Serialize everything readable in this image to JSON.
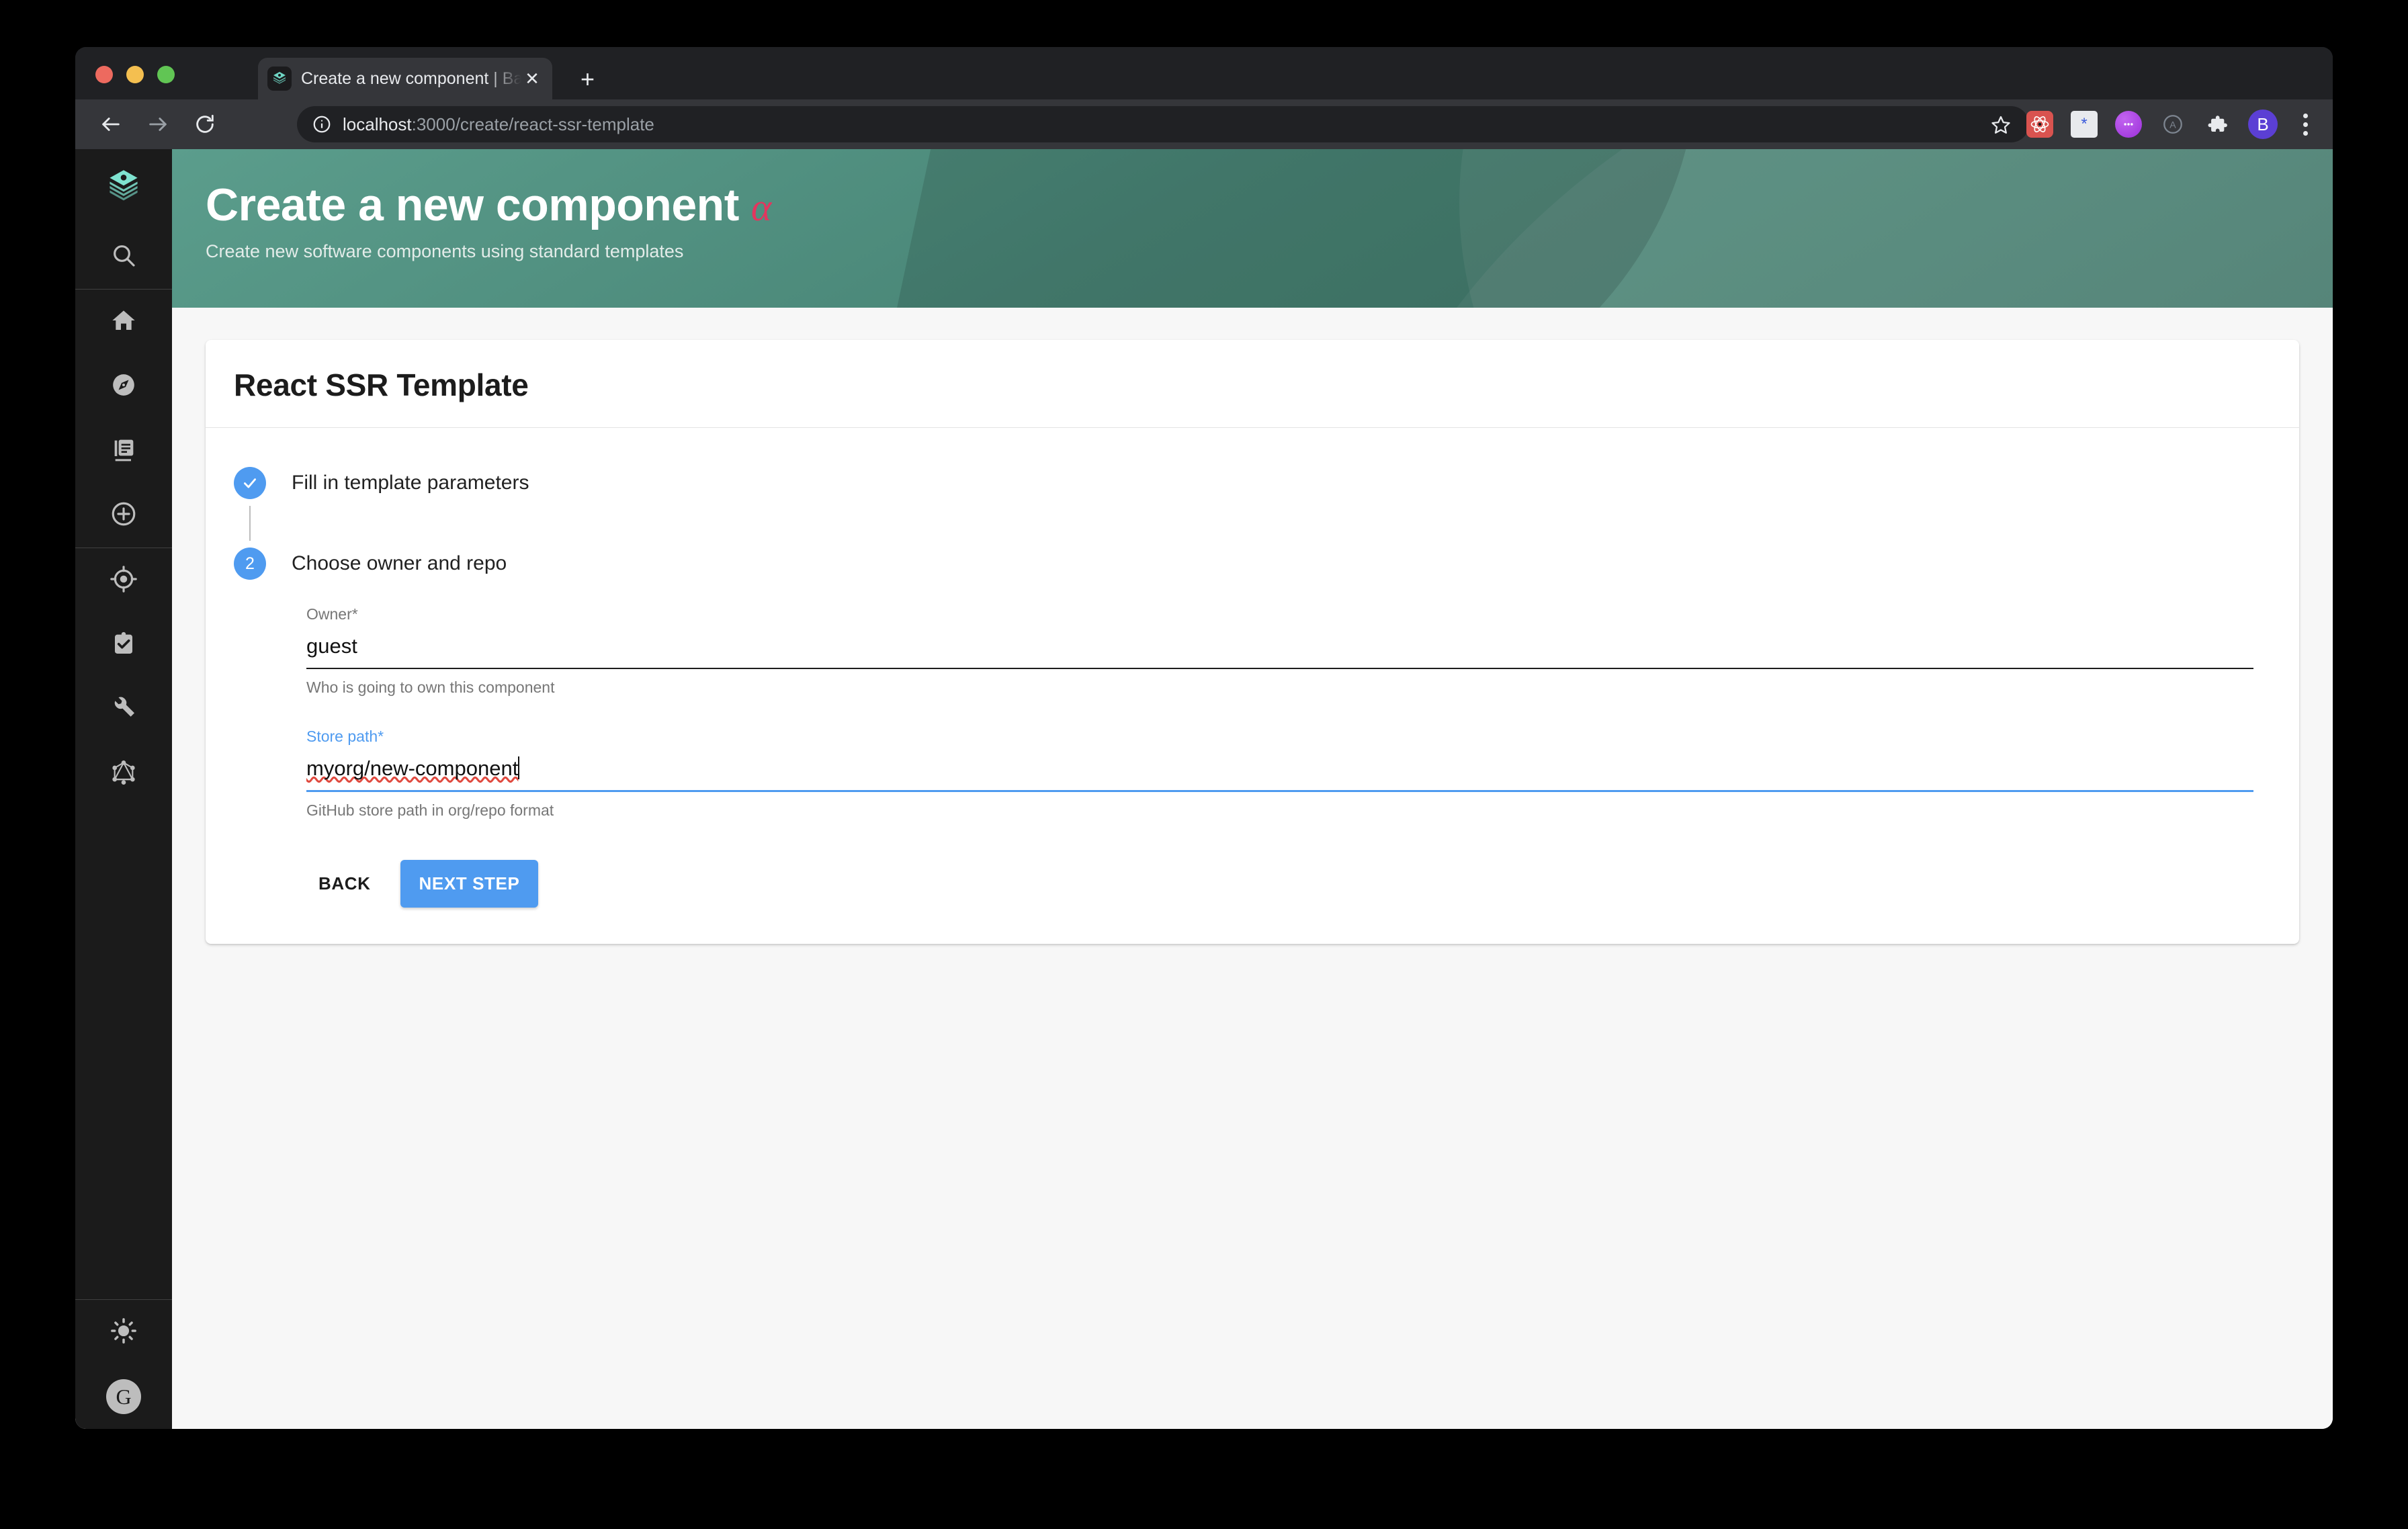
{
  "browser": {
    "tab": {
      "title": "Create a new component | Bac",
      "favicon_icon": "backstage-logo-icon",
      "close_icon": "close-icon",
      "new_tab_icon": "plus-icon"
    },
    "toolbar": {
      "back_icon": "arrow-left-icon",
      "forward_icon": "arrow-right-icon",
      "reload_icon": "reload-icon",
      "info_icon": "info-circle-icon",
      "star_icon": "star-icon",
      "url_host": "localhost",
      "url_path": ":3000/create/react-ssr-template",
      "extensions": [
        {
          "name": "react-devtools-icon",
          "label": "⚛"
        },
        {
          "name": "password-manager-icon",
          "label": "∗"
        },
        {
          "name": "purple-assistant-icon",
          "label": ""
        },
        {
          "name": "adblock-icon",
          "label": "A"
        },
        {
          "name": "extensions-puzzle-icon",
          "label": ""
        }
      ],
      "profile_avatar_label": "B",
      "menu_icon": "kebab-menu-icon"
    }
  },
  "sidebar": {
    "logo_icon": "backstage-logo-icon",
    "items": [
      {
        "name": "sidebar-item-search",
        "icon": "search-icon"
      },
      {
        "name": "sidebar-item-home",
        "icon": "home-icon"
      },
      {
        "name": "sidebar-item-explore",
        "icon": "compass-icon"
      },
      {
        "name": "sidebar-item-docs",
        "icon": "library-books-icon"
      },
      {
        "name": "sidebar-item-create",
        "icon": "plus-circle-icon"
      },
      {
        "name": "sidebar-item-tech-radar",
        "icon": "target-icon"
      },
      {
        "name": "sidebar-item-lighthouse",
        "icon": "clipboard-check-icon"
      },
      {
        "name": "sidebar-item-tools",
        "icon": "wrench-icon"
      },
      {
        "name": "sidebar-item-graphiql",
        "icon": "graphql-icon"
      }
    ],
    "theme_toggle_icon": "sun-icon",
    "user_avatar_label": "G"
  },
  "header": {
    "title": "Create a new component",
    "title_badge": "α",
    "subtitle": "Create new software components using standard templates",
    "accent_color": "#e4355e",
    "background_color": "#4a8778"
  },
  "card": {
    "title": "React SSR Template",
    "steps": [
      {
        "label": "Fill in template parameters",
        "state": "completed",
        "marker": "✓"
      },
      {
        "label": "Choose owner and repo",
        "state": "active",
        "marker": "2"
      }
    ],
    "fields": [
      {
        "label": "Owner*",
        "value": "guest",
        "help": "Who is going to own this component",
        "focused": false
      },
      {
        "label": "Store path*",
        "value": "myorg/new-component",
        "help": "GitHub store path in org/repo format",
        "focused": true
      }
    ],
    "buttons": {
      "back_label": "BACK",
      "next_label": "NEXT STEP"
    },
    "accent_color": "#4f9bf0"
  }
}
